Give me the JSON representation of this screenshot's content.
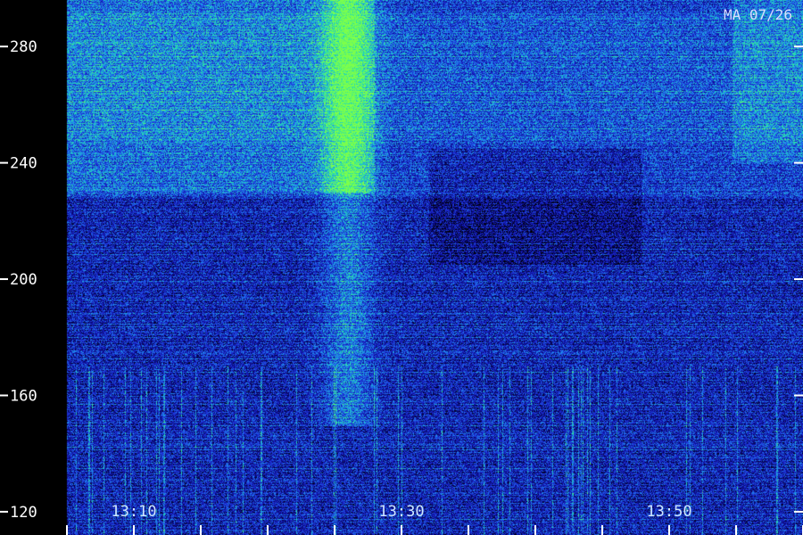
{
  "station_label": "MA 07/26",
  "chart_data": {
    "type": "heatmap",
    "title": "",
    "xlabel": "",
    "ylabel": "",
    "x_tick_labels": [
      "13:10",
      "13:30",
      "13:50"
    ],
    "x_minor_ticks": 12,
    "y_ticks": [
      120,
      160,
      200,
      240,
      280
    ],
    "y_tick_labels": [
      "120",
      "160",
      "200",
      "240",
      "280"
    ],
    "ylim": [
      112,
      296
    ],
    "colormap": [
      "#000000",
      "#0a0a8a",
      "#1e2fd6",
      "#1f8cf0",
      "#22e0b0",
      "#7dff4a"
    ],
    "features": [
      {
        "name": "bright band",
        "freq_range": [
          230,
          290
        ],
        "intensity": "high"
      },
      {
        "name": "burst column near 13:24",
        "freq_range": [
          140,
          290
        ],
        "intensity": "high"
      },
      {
        "name": "low-frequency impulsive noise",
        "freq_range": [
          112,
          170
        ],
        "intensity": "medium"
      }
    ]
  }
}
